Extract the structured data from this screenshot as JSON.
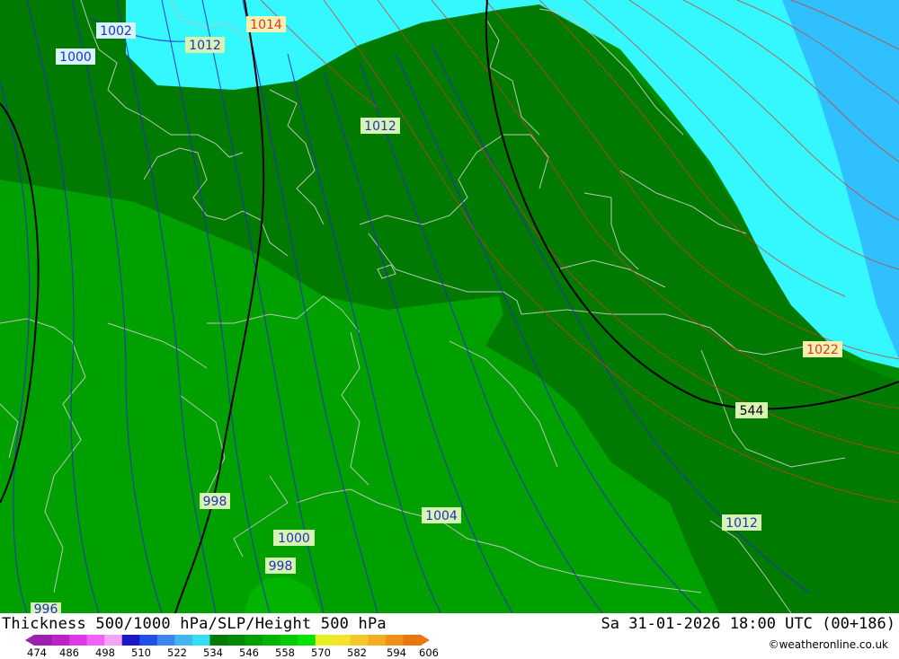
{
  "map": {
    "isobar_labels": [
      {
        "text": "1002",
        "color": "#2a2acc"
      },
      {
        "text": "1000",
        "color": "#2a2acc"
      },
      {
        "text": "1012",
        "color": "#2a2acc"
      },
      {
        "text": "1014",
        "color": "#d03a2a"
      },
      {
        "text": "1012",
        "color": "#2a2acc"
      },
      {
        "text": "1022",
        "color": "#d03a2a"
      },
      {
        "text": "544",
        "color": "#000000"
      },
      {
        "text": "1012",
        "color": "#2a2acc"
      },
      {
        "text": "998",
        "color": "#2a2acc"
      },
      {
        "text": "1004",
        "color": "#2a2acc"
      },
      {
        "text": "1000",
        "color": "#2a2acc"
      },
      {
        "text": "998",
        "color": "#2a2acc"
      },
      {
        "text": "996",
        "color": "#2a2acc"
      }
    ],
    "colors": {
      "cyan": "#35f8ff",
      "light_blue": "#30c0ff",
      "dark_green": "#007a00",
      "mid_green": "#008c00",
      "bright_green": "#00a000",
      "light_green": "#00b400",
      "low_isobar": "#2a2acc",
      "high_isobar": "#d03a2a",
      "height_contour": "#000000",
      "border": "#b8c8b8"
    }
  },
  "footer": {
    "title": "Thickness 500/1000 hPa/SLP/Height 500 hPa",
    "datetime": "Sa 31-01-2026 18:00 UTC (00+186)",
    "credit": "©weatheronline.co.uk",
    "scale_colors": [
      "#9c1fb0",
      "#bd22c9",
      "#df38e6",
      "#f261f5",
      "#f5a3f5",
      "#1818c8",
      "#2050e8",
      "#3a86ee",
      "#42b6f0",
      "#33dff5",
      "#007a00",
      "#008c00",
      "#00a000",
      "#00b400",
      "#00cc00",
      "#00e600",
      "#e6f020",
      "#f5e22a",
      "#f5c828",
      "#f4ac20",
      "#f09018",
      "#e87710"
    ],
    "scale_ticks": [
      "474",
      "486",
      "498",
      "510",
      "522",
      "534",
      "546",
      "558",
      "570",
      "582",
      "594",
      "606"
    ]
  }
}
